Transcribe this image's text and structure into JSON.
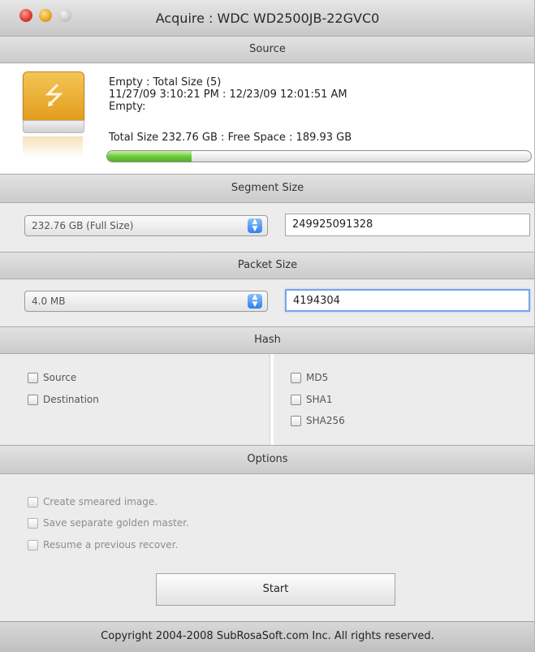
{
  "window": {
    "title": "Acquire : WDC WD2500JB-22GVC0"
  },
  "source": {
    "header": "Source",
    "line1": "Empty  : Total Size (5)",
    "line2": "11/27/09 3:10:21 PM : 12/23/09 12:01:51 AM",
    "line3": "Empty:",
    "size_line": "Total Size 232.76 GB : Free Space : 189.93 GB",
    "progress_fraction": 0.2,
    "icon": "usb-drive-icon"
  },
  "segment": {
    "header": "Segment Size",
    "select_value": "232.76 GB (Full Size)",
    "field_value": "249925091328"
  },
  "packet": {
    "header": "Packet Size",
    "select_value": "4.0 MB",
    "field_value": "4194304"
  },
  "hash": {
    "header": "Hash",
    "left_items": [
      "Source",
      "Destination"
    ],
    "right_items": [
      "MD5",
      "SHA1",
      "SHA256"
    ]
  },
  "options": {
    "header": "Options",
    "items": [
      "Create smeared image.",
      "Save separate golden master.",
      "Resume a previous recover."
    ]
  },
  "start_label": "Start",
  "footer": "Copyright 2004-2008 SubRosaSoft.com Inc. All rights reserved."
}
